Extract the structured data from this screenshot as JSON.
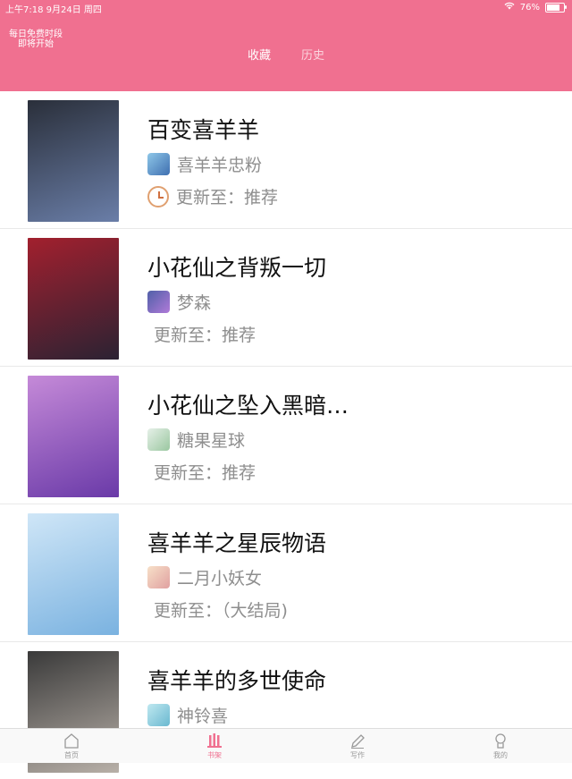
{
  "status_bar": {
    "time_date": "上午7:18  9月24日 周四",
    "battery_text": "76%",
    "battery_level": 0.76
  },
  "header": {
    "free_note_line1": "每日免费时段",
    "free_note_line2": "即将开始",
    "tabs": [
      {
        "label": "收藏",
        "active": true
      },
      {
        "label": "历史",
        "active": false
      }
    ]
  },
  "books": [
    {
      "title": "百变喜羊羊",
      "author": "喜羊羊忠粉",
      "update": "更新至：推荐",
      "show_clock": true,
      "cover_colors": [
        "#2a2f3a",
        "#6a7ea8"
      ],
      "avatar_colors": [
        "#8ec7e8",
        "#3f6fb0"
      ]
    },
    {
      "title": "小花仙之背叛一切",
      "author": "梦森",
      "update": "更新至：推荐",
      "show_clock": false,
      "cover_colors": [
        "#a2202e",
        "#2b2233"
      ],
      "avatar_colors": [
        "#5060a8",
        "#b07ad8"
      ]
    },
    {
      "title": "小花仙之坠入黑暗…",
      "author": "糖果星球",
      "update": "更新至：推荐",
      "show_clock": false,
      "cover_colors": [
        "#c58ad8",
        "#6a3aa8"
      ],
      "avatar_colors": [
        "#e6f0e8",
        "#9ac7a0"
      ]
    },
    {
      "title": "喜羊羊之星辰物语",
      "author": "二月小妖女",
      "update": "更新至：（大结局)",
      "show_clock": false,
      "cover_colors": [
        "#cfe6f7",
        "#7ab2e0"
      ],
      "avatar_colors": [
        "#f7e0c8",
        "#e0a0a0"
      ]
    },
    {
      "title": "喜羊羊的多世使命",
      "author": "神铃喜",
      "update": "",
      "show_clock": false,
      "cover_colors": [
        "#3a3a3a",
        "#b8b0a8"
      ],
      "avatar_colors": [
        "#bfe8f0",
        "#6ab8d0"
      ]
    }
  ],
  "tabbar": [
    {
      "label": "首页",
      "icon": "home-icon",
      "active": false
    },
    {
      "label": "书架",
      "icon": "bookshelf-icon",
      "active": true
    },
    {
      "label": "写作",
      "icon": "pen-icon",
      "active": false
    },
    {
      "label": "我的",
      "icon": "profile-icon",
      "active": false
    }
  ],
  "colors": {
    "accent": "#f07090",
    "secondary_text": "#8e8e8e"
  }
}
